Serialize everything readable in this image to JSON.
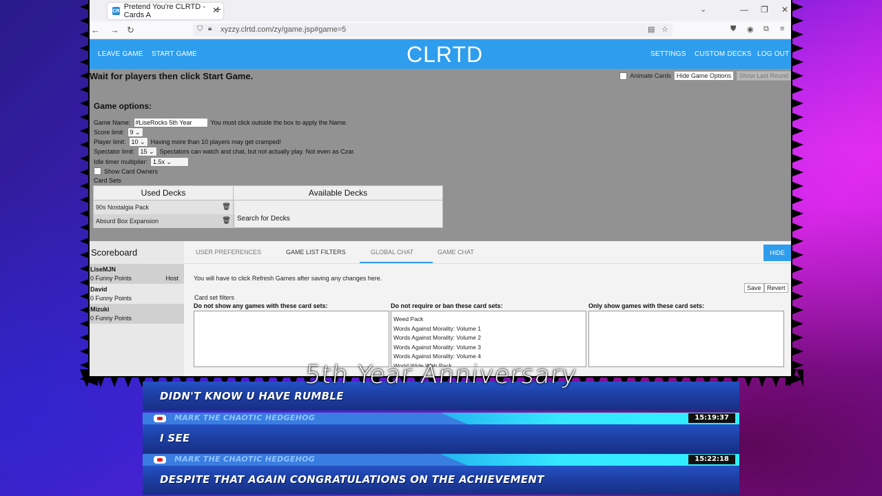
{
  "browser": {
    "tab_title": "Pretend You're CLRTD - Cards A",
    "tab_favicon": "CR",
    "url": "xyzzy.clrtd.com/zy/game.jsp#game=5"
  },
  "header": {
    "leave_game": "LEAVE GAME",
    "start_game": "START GAME",
    "brand": "CLRTD",
    "settings": "SETTINGS",
    "custom_decks": "CUSTOM DECKS",
    "log_out": "LOG OUT"
  },
  "game": {
    "status": "Wait for players then click Start Game.",
    "animate_cards": "Animate Cards",
    "hide_options": "Hide Game Options",
    "show_last_round": "Show Last Round",
    "options_title": "Game options:",
    "game_name_label": "Game Name:",
    "game_name_value": "#LiseRocks 5th Year",
    "game_name_hint": "You must click outside the box to apply the Name.",
    "score_limit_label": "Score limit:",
    "score_limit_value": "9",
    "player_limit_label": "Player limit:",
    "player_limit_value": "10",
    "player_limit_hint": "Having more than 10 players may get cramped!",
    "spectator_limit_label": "Spectator limit:",
    "spectator_limit_value": "15",
    "spectator_hint": "Spectators can watch and chat, but not actually play. Not even as Czar.",
    "idle_label": "Idle timer multiplier:",
    "idle_value": "1.5x",
    "show_owners": "Show Card Owners",
    "card_sets": "Card Sets",
    "used_decks_header": "Used Decks",
    "available_decks_header": "Available Decks",
    "used_decks": [
      "90s Nostalgia Pack",
      "Absurd Box Expansion"
    ],
    "search_decks": "Search for Decks"
  },
  "scoreboard": {
    "title": "Scoreboard",
    "players": [
      {
        "name": "LiseMJN",
        "points": "0 Funny Points",
        "host": "Host"
      },
      {
        "name": "David",
        "points": "0 Funny Points",
        "host": ""
      },
      {
        "name": "Mizuki",
        "points": "0 Funny Points",
        "host": ""
      }
    ]
  },
  "panel": {
    "tabs": [
      "USER PREFERENCES",
      "GAME LIST FILTERS",
      "GLOBAL CHAT",
      "GAME CHAT"
    ],
    "active_tab": "GAME LIST FILTERS",
    "hide": "HIDE",
    "refresh_note": "You will have to click Refresh Games after saving any changes here.",
    "save": "Save",
    "revert": "Revert",
    "card_set_filters": "Card set filters",
    "col1": "Do not show any games with these card sets:",
    "col2": "Do not require or ban these card sets:",
    "col3": "Only show games with these card sets:",
    "col2_items": [
      "Weed Pack",
      "Words Against Morality: Volume 1",
      "Words Against Morality: Volume 2",
      "Words Against Morality: Volume 3",
      "Words Against Morality: Volume 4",
      "World Wide Web Pack"
    ]
  },
  "overlay": {
    "banner": "5th Year Anniversary",
    "messages": [
      {
        "user": "",
        "time": "",
        "text": "DIDN'T KNOW U HAVE RUMBLE"
      },
      {
        "user": "MARK THE CHAOTIC HEDGEHOG",
        "time": "15:19:37",
        "text": "I SEE"
      },
      {
        "user": "MARK THE CHAOTIC HEDGEHOG",
        "time": "15:22:18",
        "text": "DESPITE THAT AGAIN CONGRATULATIONS ON THE ACHIEVEMENT"
      }
    ]
  }
}
